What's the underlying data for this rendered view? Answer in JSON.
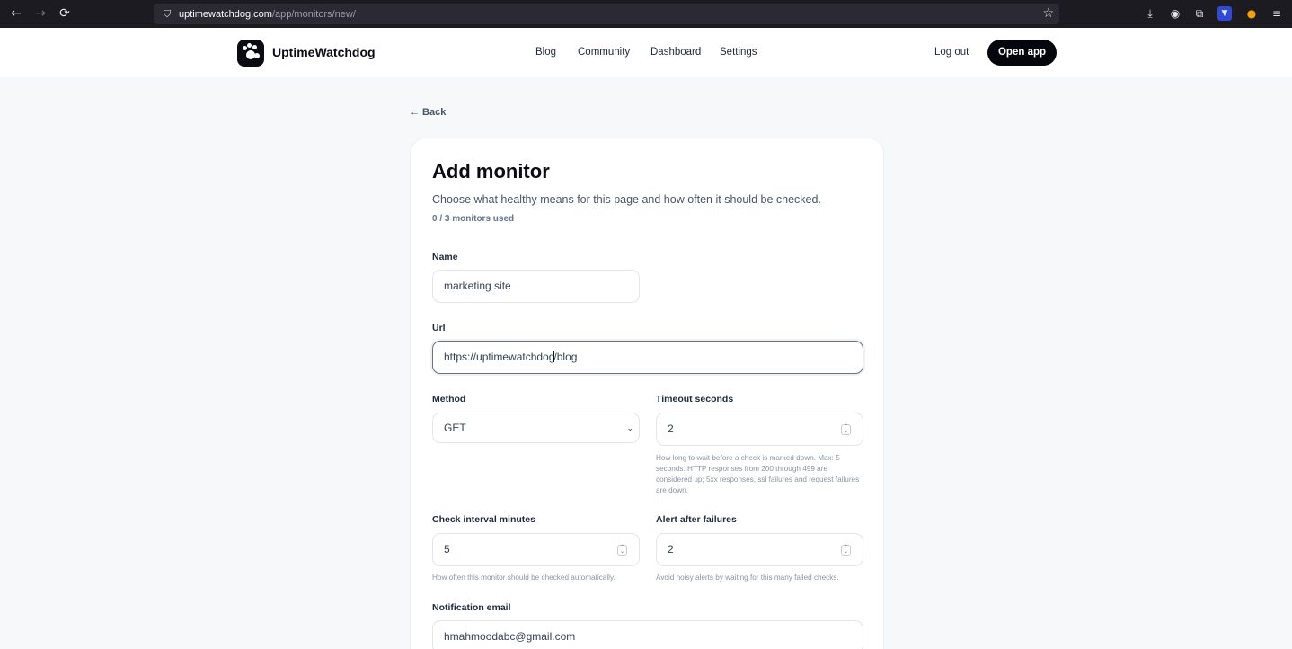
{
  "browser": {
    "url_host": "uptimewatchdog.com",
    "url_path": "/app/monitors/new/"
  },
  "header": {
    "brand": "UptimeWatchdog",
    "nav": [
      "Blog",
      "Community",
      "Dashboard",
      "Settings"
    ],
    "logout": "Log out",
    "open_app": "Open app"
  },
  "page": {
    "back": "← Back",
    "title": "Add monitor",
    "subtitle": "Choose what healthy means for this page and how often it should be checked.",
    "usage": "0 / 3 monitors used"
  },
  "form": {
    "name": {
      "label": "Name",
      "value": "marketing site"
    },
    "url": {
      "label": "Url",
      "value_before_caret": "https://uptimewatchdog",
      "value_after_caret": "/blog"
    },
    "method": {
      "label": "Method",
      "value": "GET"
    },
    "timeout": {
      "label": "Timeout seconds",
      "value": "2",
      "help": "How long to wait before a check is marked down. Max: 5 seconds. HTTP responses from 200 through 499 are considered up; 5xx responses, ssl failures and request failures are down."
    },
    "interval": {
      "label": "Check interval minutes",
      "value": "5",
      "help": "How often this monitor should be checked automatically."
    },
    "alert": {
      "label": "Alert after failures",
      "value": "2",
      "help": "Avoid noisy alerts by waiting for this many failed checks."
    },
    "email": {
      "label": "Notification email",
      "value": "hmahmoodabc@gmail.com"
    }
  }
}
